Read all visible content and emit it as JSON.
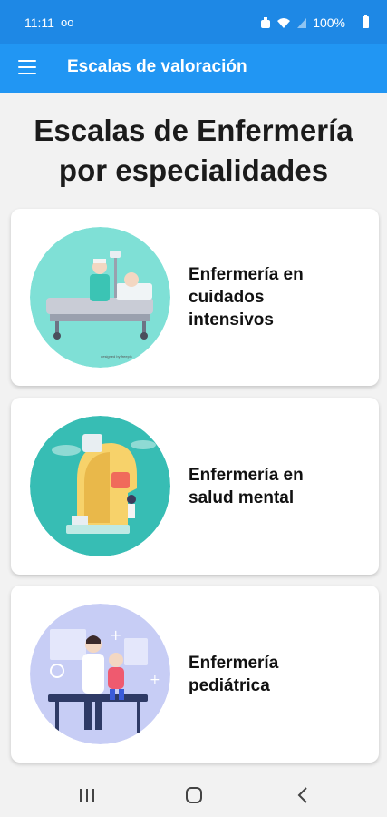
{
  "status_bar": {
    "time": "11:11",
    "voicemail": "oo",
    "battery": "100%",
    "icons": [
      "hd-icon",
      "wifi-icon",
      "signal-icon",
      "battery-icon"
    ]
  },
  "app_bar": {
    "title": "Escalas de valoración",
    "menu_icon": "hamburger-menu-icon",
    "color": "#2196f3"
  },
  "page_title": {
    "line1": "Escalas de Enfermería",
    "line2": "por especialidades"
  },
  "cards": [
    {
      "line1": "Enfermería en",
      "line2": "cuidados",
      "line3": "intensivos",
      "illustration": "icu-bed-illustration"
    },
    {
      "line1": "Enfermería en",
      "line2": "salud mental",
      "illustration": "mental-health-head-illustration"
    },
    {
      "line1": "Enfermería",
      "line2": "pediátrica",
      "illustration": "pediatric-nurse-illustration"
    }
  ],
  "nav_bar": {
    "icons": [
      "recent-apps-icon",
      "home-icon",
      "back-icon"
    ]
  }
}
